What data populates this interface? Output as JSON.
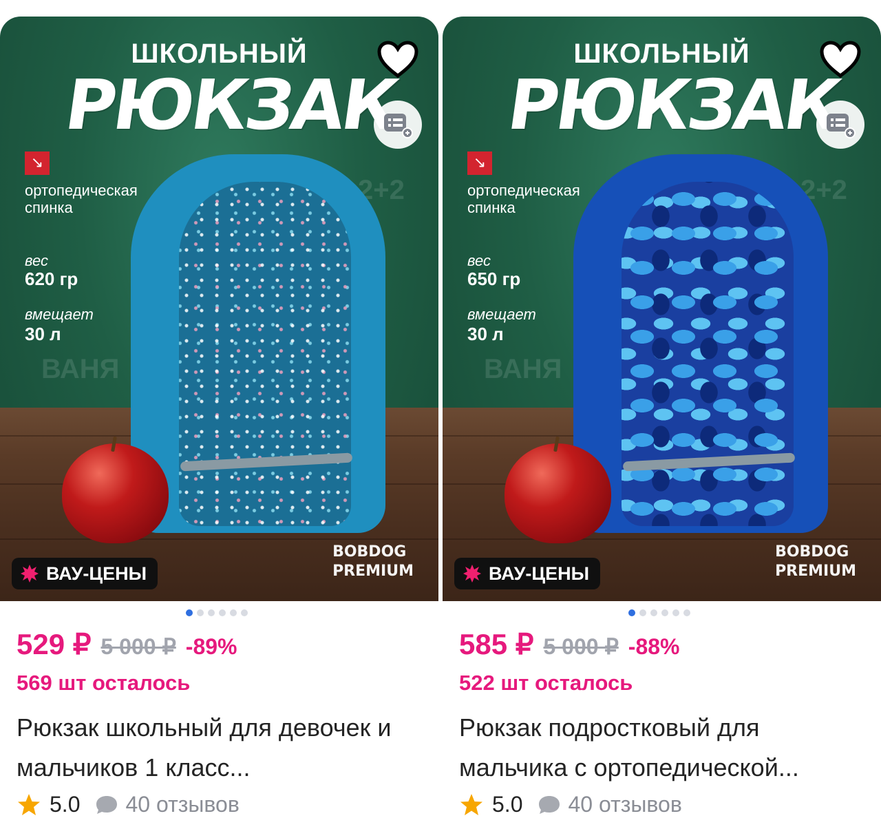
{
  "products": [
    {
      "headline_small": "ШКОЛЬНЫЙ",
      "headline_big": "РЮКЗАК",
      "feature_back": "ортопедическая спинка",
      "weight_label": "вес",
      "weight_value": "620 гр",
      "capacity_label": "вмещает",
      "capacity_value": "30 л",
      "badge": "ВАУ-ЦЕНЫ",
      "brand_line1": "BOBDOG",
      "brand_line2": "PREMIUM",
      "price": "529 ₽",
      "old_price": "5 000 ₽",
      "discount": "-89%",
      "stock": "569 шт осталось",
      "name": "Рюкзак школьный для девочек и мальчиков 1 класс...",
      "rating": "5.0",
      "reviews": "40 отзывов",
      "photo_count": 6,
      "active_photo": 1,
      "backpack_color": "#1f8fbf"
    },
    {
      "headline_small": "ШКОЛЬНЫЙ",
      "headline_big": "РЮКЗАК",
      "feature_back": "ортопедическая спинка",
      "weight_label": "вес",
      "weight_value": "650 гр",
      "capacity_label": "вмещает",
      "capacity_value": "30 л",
      "badge": "ВАУ-ЦЕНЫ",
      "brand_line1": "BOBDOG",
      "brand_line2": "PREMIUM",
      "price": "585 ₽",
      "old_price": "5 000 ₽",
      "discount": "-88%",
      "stock": "522 шт осталось",
      "name": "Рюкзак подростковый для мальчика с ортопедической...",
      "rating": "5.0",
      "reviews": "40 отзывов",
      "photo_count": 6,
      "active_photo": 1,
      "backpack_color": "#1650b8"
    }
  ],
  "colors": {
    "accent_pink": "#e6197d",
    "active_dot": "#2f6fe0",
    "star": "#f7a600"
  },
  "icons": [
    "heart-icon",
    "compare-add-icon",
    "burst-icon",
    "star-icon",
    "comment-bubble-icon",
    "down-right-arrow-icon"
  ]
}
